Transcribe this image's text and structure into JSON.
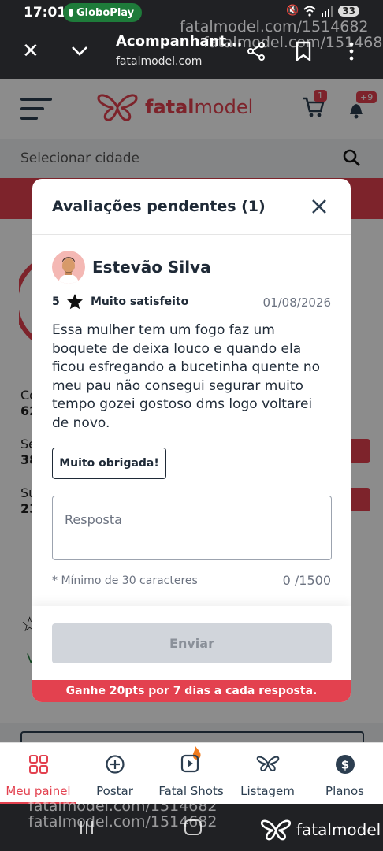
{
  "status_bar": {
    "time": "17:01",
    "app_pill": "GloboPlay",
    "battery": "33"
  },
  "browser": {
    "title": "Acompanhant...",
    "url": "fatalmodel.com",
    "watermarks": [
      "fatalmodel.com/1514682",
      "fatalmodel.com/1514682",
      "fatalmodel.com/1514682",
      "fatalmodel.com/1514682"
    ]
  },
  "site": {
    "logo_prefix": "fatal",
    "logo_suffix": "model",
    "cart_badge": "1",
    "notif_badge": "+9",
    "city_placeholder": "Selecionar cidade",
    "behind_fragments": [
      "Co",
      "62",
      "Se",
      "38",
      "Su",
      "23",
      "V"
    ]
  },
  "modal": {
    "title": "Avaliações pendentes (1)",
    "reviewer_name": "Estevão Silva",
    "rating_value": "5",
    "rating_label": "Muito satisfeito",
    "date": "01/08/2026",
    "review_text": "Essa mulher tem um fogo faz um boquete de deixa louco e quando ela ficou esfregando a bucetinha quente no meu pau não consegui segurar muito tempo gozei gostoso dms logo voltarei de novo.",
    "quick_reply_label": "Muito obrigada!",
    "reply_placeholder": "Resposta",
    "min_chars_note": "* Mínimo de 30 caracteres",
    "char_counter": "0 /1500",
    "send_label": "Enviar",
    "promo_text": "Ganhe 20pts por 7 dias a cada resposta."
  },
  "bottom_nav": {
    "items": [
      {
        "label": "Meu painel",
        "icon": "grid-icon"
      },
      {
        "label": "Postar",
        "icon": "plus-circle-icon"
      },
      {
        "label": "Fatal Shots",
        "icon": "video-fire-icon"
      },
      {
        "label": "Listagem",
        "icon": "butterfly-icon"
      },
      {
        "label": "Planos",
        "icon": "dollar-icon"
      }
    ]
  },
  "android_nav": {
    "brand": "fatalmodel"
  },
  "colors": {
    "brand_red": "#e3414f",
    "dark_text": "#1f2a37",
    "disabled_btn": "#d1d5db"
  }
}
